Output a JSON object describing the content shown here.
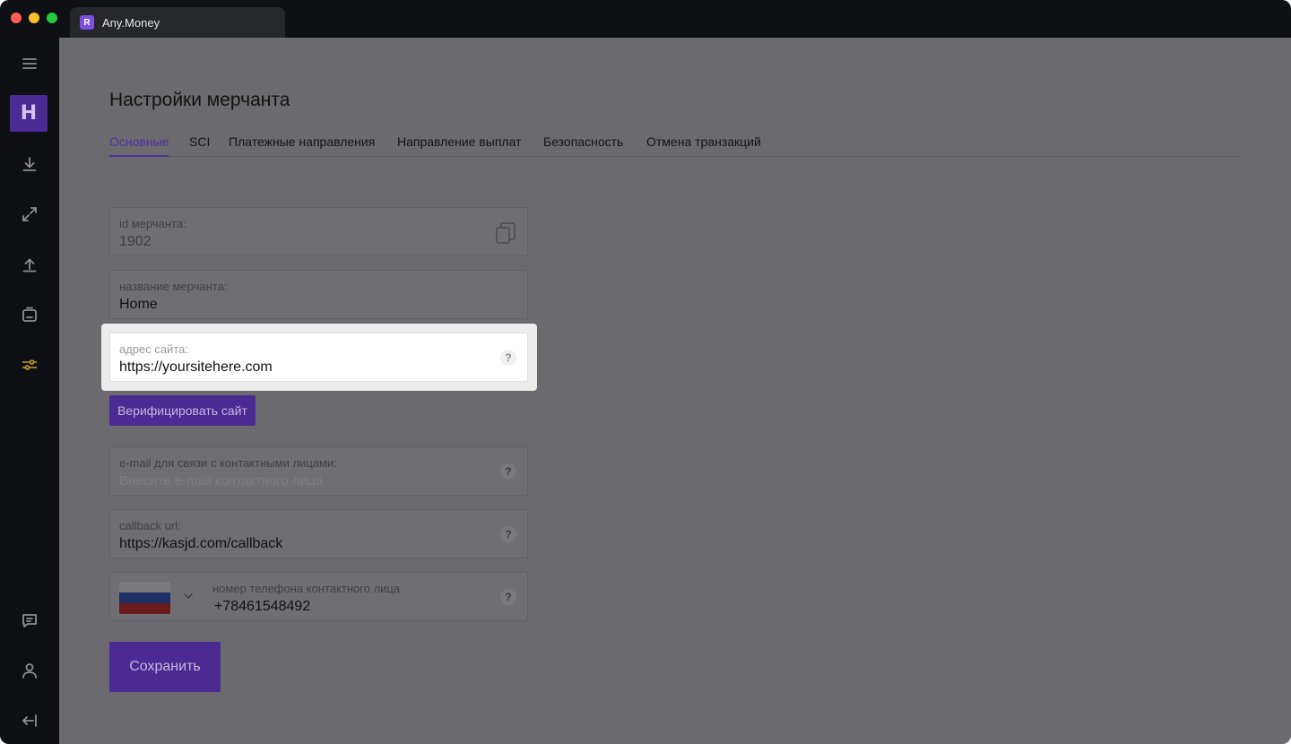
{
  "browser": {
    "tab_title": "Any.Money",
    "favicon_letter": "R"
  },
  "sidebar": {
    "logo_letter": "H",
    "accent_color": "#c9a227"
  },
  "page": {
    "title": "Настройки мерчанта",
    "tabs": [
      {
        "label": "Основные",
        "active": true
      },
      {
        "label": "SCI",
        "active": false
      },
      {
        "label": "Платежные направления",
        "active": false
      },
      {
        "label": "Направление выплат",
        "active": false
      },
      {
        "label": "Безопасность",
        "active": false
      },
      {
        "label": "Отмена транзакций",
        "active": false
      }
    ]
  },
  "form": {
    "merchant_id": {
      "label": "id мерчанта:",
      "value": "1902"
    },
    "merchant_name": {
      "label": "название мерчанта:",
      "value": "Home"
    },
    "site_address": {
      "label": "адрес сайта:",
      "value": "https://yoursitehere.com"
    },
    "verify_button": "Верифицировать сайт",
    "contact_email": {
      "label": "e-mail для связи с контактными лицами:",
      "placeholder": "Внесите e-mail контактного лица"
    },
    "callback_url": {
      "label": "callback url:",
      "value": "https://kasjd.com/callback"
    },
    "phone": {
      "label": "номер телефона контактного лица",
      "value": "+78461548492"
    },
    "help_glyph": "?",
    "save_button": "Сохранить"
  },
  "colors": {
    "brand_purple": "#4a2a93",
    "overlay_gray": "#6b6b6f"
  }
}
